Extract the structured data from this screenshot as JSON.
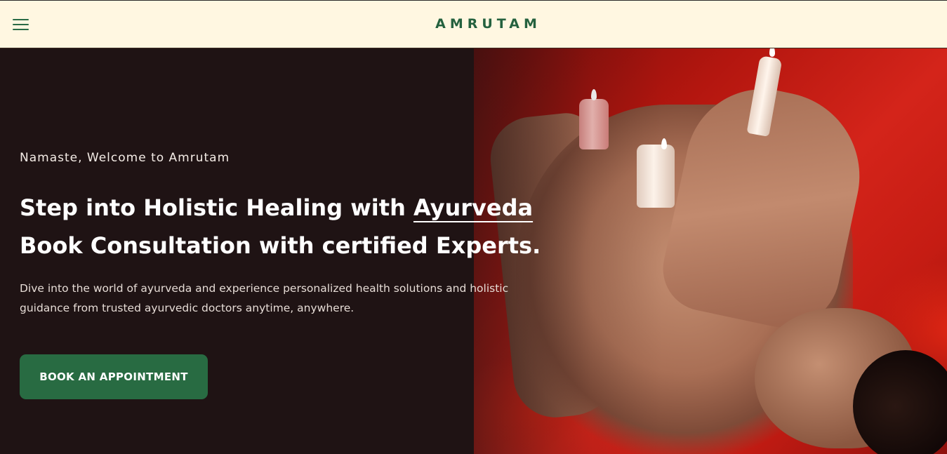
{
  "header": {
    "logo_text": "AMRUTAM",
    "menu_icon": "hamburger-menu-icon",
    "background_color": "#fff7e1",
    "brand_color": "#24613e"
  },
  "hero": {
    "greeting": "Namaste, Welcome to Amrutam",
    "headline_part1": "Step into Holistic Healing with ",
    "headline_highlight": "Ayurveda",
    "headline_line2": "Book Consultation with certified Experts.",
    "description": "Dive into the world of ayurveda and experience personalized health solutions and holistic guidance from trusted ayurvedic doctors anytime, anywhere.",
    "cta_label": "BOOK AN APPOINTMENT",
    "cta_color": "#286b42",
    "background_color": "#1f1314"
  }
}
